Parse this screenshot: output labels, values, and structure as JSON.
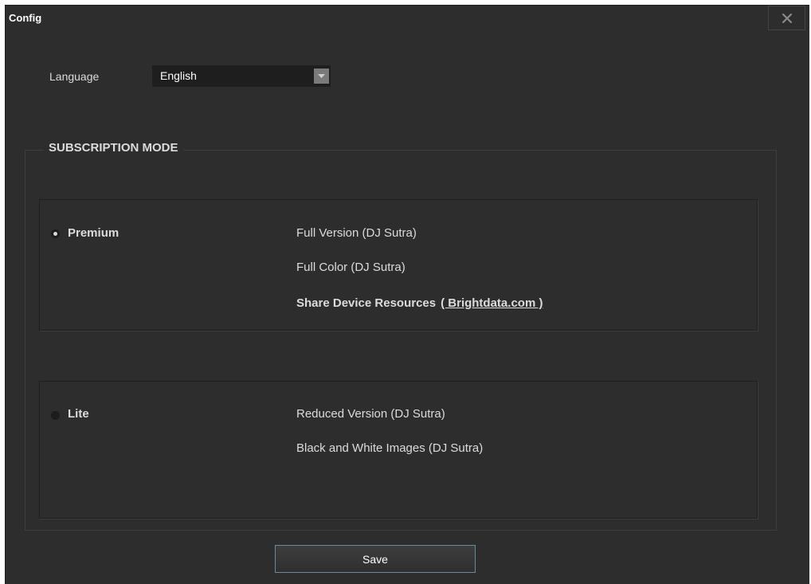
{
  "window": {
    "title": "Config",
    "close_icon": "close-icon"
  },
  "language": {
    "label": "Language",
    "selected": "English"
  },
  "subscription": {
    "legend": "SUBSCRIPTION MODE",
    "premium": {
      "label": "Premium",
      "selected": true,
      "features": [
        "Full Version (DJ Sutra)",
        "Full Color (DJ Sutra)"
      ],
      "share_text": "Share Device Resources",
      "share_link": "( Brightdata.com )"
    },
    "lite": {
      "label": "Lite",
      "selected": false,
      "features": [
        "Reduced Version (DJ Sutra)",
        "Black and White Images (DJ Sutra)"
      ]
    }
  },
  "actions": {
    "save_label": "Save"
  }
}
